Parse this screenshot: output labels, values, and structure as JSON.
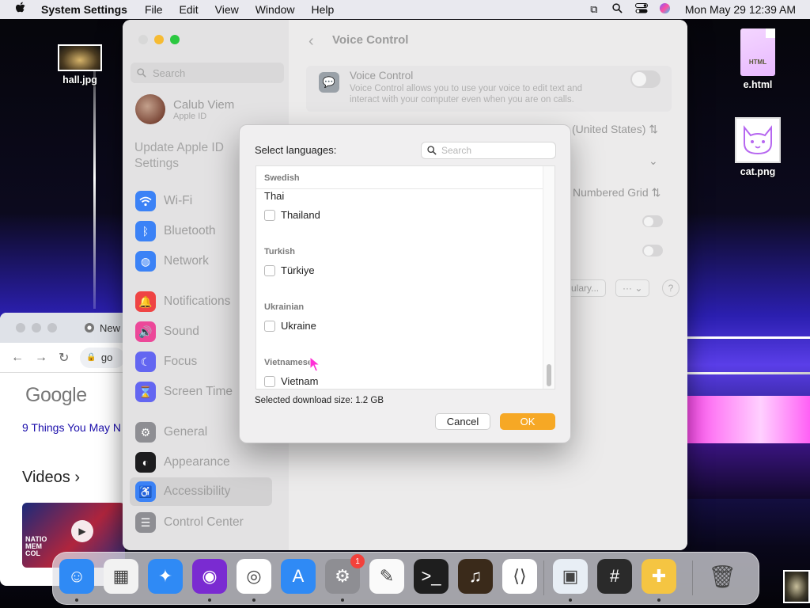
{
  "menubar": {
    "app_name": "System Settings",
    "menus": [
      "File",
      "Edit",
      "View",
      "Window",
      "Help"
    ],
    "clock": "Mon May 29  12:39 AM"
  },
  "desktop": {
    "icons": [
      {
        "label": "hall.jpg"
      },
      {
        "label": "e.html",
        "file_badge": "HTML"
      },
      {
        "label": "cat.png"
      }
    ]
  },
  "chrome": {
    "tab_title": "New",
    "address": "go",
    "google_logo": "Google",
    "link_text": "9 Things You May N",
    "videos_heading": "Videos",
    "video_overlay": "NATIO MEM COL"
  },
  "settings": {
    "search_placeholder": "Search",
    "profile_name": "Calub Viem",
    "profile_sub": "Apple ID",
    "update_text": "Update Apple ID Settings",
    "sidebar_items": [
      {
        "label": "Wi-Fi",
        "icon": "wifi-icon",
        "color": "#3b82f6"
      },
      {
        "label": "Bluetooth",
        "icon": "bluetooth-icon",
        "color": "#3b82f6"
      },
      {
        "label": "Network",
        "icon": "globe-icon",
        "color": "#3b82f6"
      },
      {
        "label": "Notifications",
        "icon": "bell-icon",
        "color": "#ef4444"
      },
      {
        "label": "Sound",
        "icon": "speaker-icon",
        "color": "#ec4899"
      },
      {
        "label": "Focus",
        "icon": "moon-icon",
        "color": "#6366f1"
      },
      {
        "label": "Screen Time",
        "icon": "hourglass-icon",
        "color": "#6366f1"
      },
      {
        "label": "General",
        "icon": "gear-icon",
        "color": "#8e8e93"
      },
      {
        "label": "Appearance",
        "icon": "appearance-icon",
        "color": "#1c1c1e"
      },
      {
        "label": "Accessibility",
        "icon": "accessibility-icon",
        "color": "#3b82f6"
      },
      {
        "label": "Control Center",
        "icon": "control-center-icon",
        "color": "#8e8e93"
      }
    ],
    "page_title": "Voice Control",
    "voice_control_title": "Voice Control",
    "voice_control_desc": "Voice Control allows you to use your voice to edit text and interact with your computer even when you are on calls.",
    "language_value": "(United States)",
    "overlay_value": "Numbered Grid",
    "vocabulary_button": "ulary...",
    "more_button": "···",
    "help_button": "?"
  },
  "dialog": {
    "title": "Select languages:",
    "search_placeholder": "Search",
    "sticky_header": "Swedish",
    "partial_item": "Thai",
    "groups": [
      {
        "header": "",
        "items": [
          "Thailand"
        ]
      },
      {
        "header": "Turkish",
        "items": [
          "Türkiye"
        ]
      },
      {
        "header": "Ukrainian",
        "items": [
          "Ukraine"
        ]
      },
      {
        "header": "Vietnamese",
        "items": [
          "Vietnam"
        ]
      }
    ],
    "download_size": "Selected download size: 1.2 GB",
    "cancel_label": "Cancel",
    "ok_label": "OK"
  },
  "dock": {
    "apps": [
      {
        "name": "finder-icon",
        "glyph": "☺",
        "bg": "#2f8af5"
      },
      {
        "name": "launchpad-icon",
        "glyph": "▦",
        "bg": "#f2f2f2"
      },
      {
        "name": "safari-icon",
        "glyph": "✦",
        "bg": "#2f8af5"
      },
      {
        "name": "firefox-icon",
        "glyph": "◉",
        "bg": "#7a2bd1"
      },
      {
        "name": "chrome-icon",
        "glyph": "◎",
        "bg": "#ffffff"
      },
      {
        "name": "app-store-icon",
        "glyph": "A",
        "bg": "#2f8af5"
      },
      {
        "name": "system-settings-icon",
        "glyph": "⚙",
        "bg": "#8e8e93",
        "badge": "1"
      },
      {
        "name": "textedit-icon",
        "glyph": "✎",
        "bg": "#fafafa"
      },
      {
        "name": "terminal-icon",
        "glyph": ">_",
        "bg": "#1e1e1e"
      },
      {
        "name": "garageband-icon",
        "glyph": "♫",
        "bg": "#3a2a1a"
      },
      {
        "name": "vscode-icon",
        "glyph": "⟨⟩",
        "bg": "#ffffff"
      },
      {
        "name": "preview-icon",
        "glyph": "▣",
        "bg": "#e8eef5"
      },
      {
        "name": "calculator-icon",
        "glyph": "#",
        "bg": "#2a2a2a"
      },
      {
        "name": "color-picker-icon",
        "glyph": "✚",
        "bg": "#f5c542"
      },
      {
        "name": "trash-icon",
        "glyph": "🗑",
        "bg": "transparent"
      }
    ]
  }
}
